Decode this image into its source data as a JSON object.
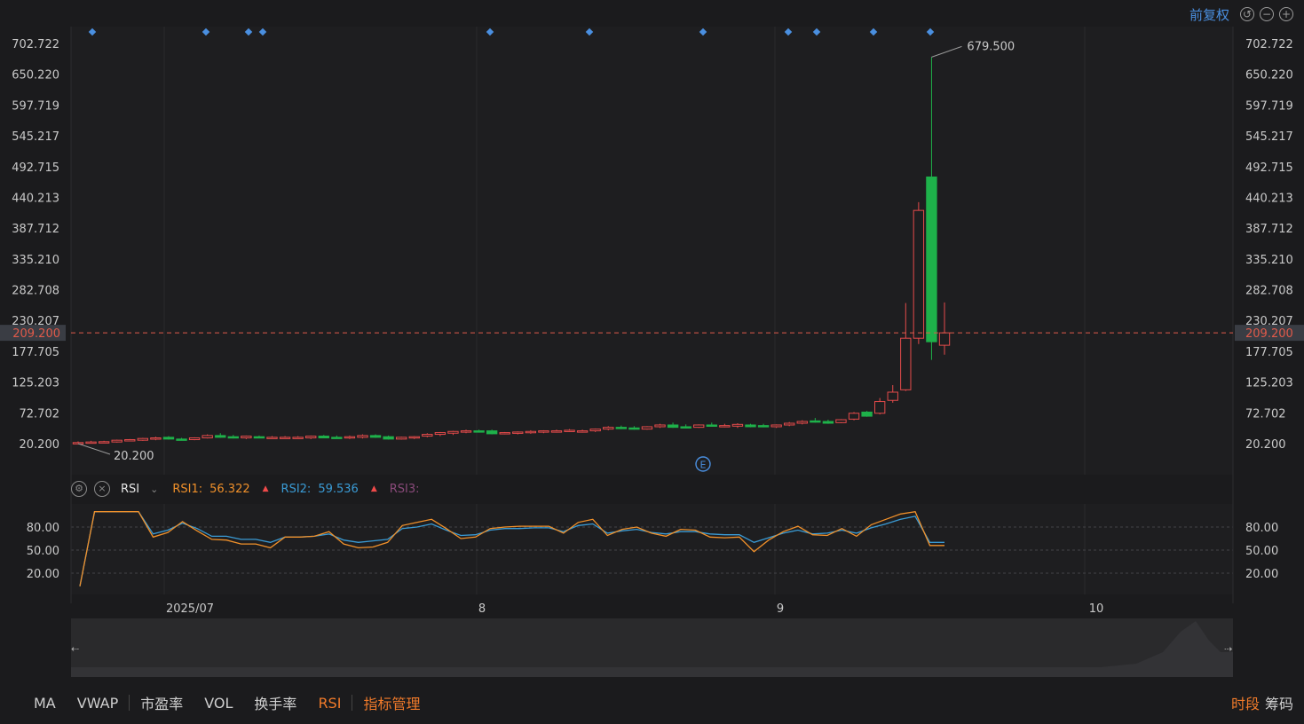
{
  "toolbar": {
    "adjust_label": "前复权"
  },
  "price_axis": {
    "ticks": [
      "702.722",
      "650.220",
      "597.719",
      "545.217",
      "492.715",
      "440.213",
      "387.712",
      "335.210",
      "282.708",
      "230.207",
      "177.705",
      "125.203",
      "72.702",
      "20.200"
    ],
    "current_price_label": "209.200"
  },
  "annotations": {
    "high_label": "679.500",
    "low_label": "20.200",
    "event_marker": "E"
  },
  "date_axis": {
    "labels": [
      "2025/07",
      "8",
      "9",
      "10"
    ]
  },
  "indicator": {
    "name": "RSI",
    "rsi1_label": "RSI1:",
    "rsi1_value": "56.322",
    "rsi2_label": "RSI2:",
    "rsi2_value": "59.536",
    "rsi3_label": "RSI3:",
    "axis_ticks": [
      "80.00",
      "50.00",
      "20.00"
    ]
  },
  "bottom_tabs": [
    "MA",
    "VWAP",
    "市盈率",
    "VOL",
    "换手率",
    "RSI",
    "指标管理"
  ],
  "bottom_right": [
    "时段",
    "筹码"
  ],
  "colors": {
    "up": "#e54b4b",
    "down": "#1eb14a",
    "accent_blue": "#4a8fe0",
    "rsi1": "#f0902a",
    "rsi2": "#3a9bd5",
    "rsi3": "#8a4a7a",
    "current_price": "#e05a4a"
  },
  "chart_data": [
    {
      "type": "candlestick",
      "ylim": [
        20.2,
        702.722
      ],
      "current_price": 209.2,
      "high": 679.5,
      "low": 20.2,
      "candles": [
        {
          "o": 20.2,
          "h": 24,
          "l": 20.2,
          "c": 22
        },
        {
          "o": 22,
          "h": 25,
          "l": 21,
          "c": 23
        },
        {
          "o": 22,
          "h": 25,
          "l": 21,
          "c": 23.5
        },
        {
          "o": 23,
          "h": 27,
          "l": 22,
          "c": 26
        },
        {
          "o": 25,
          "h": 28,
          "l": 24,
          "c": 27
        },
        {
          "o": 26,
          "h": 30,
          "l": 25,
          "c": 29
        },
        {
          "o": 28,
          "h": 32,
          "l": 26,
          "c": 30
        },
        {
          "o": 31,
          "h": 33,
          "l": 27,
          "c": 28
        },
        {
          "o": 28,
          "h": 30,
          "l": 26,
          "c": 27
        },
        {
          "o": 27,
          "h": 31,
          "l": 26,
          "c": 30
        },
        {
          "o": 30,
          "h": 36,
          "l": 29,
          "c": 34
        },
        {
          "o": 34,
          "h": 38,
          "l": 30,
          "c": 31
        },
        {
          "o": 32,
          "h": 35,
          "l": 29,
          "c": 30
        },
        {
          "o": 30,
          "h": 34,
          "l": 28,
          "c": 33
        },
        {
          "o": 32,
          "h": 34,
          "l": 30,
          "c": 31
        },
        {
          "o": 31,
          "h": 33,
          "l": 29,
          "c": 31
        },
        {
          "o": 31,
          "h": 33,
          "l": 29,
          "c": 31
        },
        {
          "o": 31,
          "h": 33,
          "l": 29,
          "c": 31
        },
        {
          "o": 30,
          "h": 34,
          "l": 28,
          "c": 33
        },
        {
          "o": 33,
          "h": 35,
          "l": 30,
          "c": 30
        },
        {
          "o": 31,
          "h": 34,
          "l": 29,
          "c": 30
        },
        {
          "o": 30,
          "h": 34,
          "l": 28,
          "c": 32
        },
        {
          "o": 31,
          "h": 36,
          "l": 29,
          "c": 34
        },
        {
          "o": 34,
          "h": 36,
          "l": 30,
          "c": 31
        },
        {
          "o": 32,
          "h": 34,
          "l": 27,
          "c": 28
        },
        {
          "o": 28,
          "h": 32,
          "l": 27,
          "c": 31
        },
        {
          "o": 30,
          "h": 33,
          "l": 28,
          "c": 32
        },
        {
          "o": 33,
          "h": 38,
          "l": 31,
          "c": 36
        },
        {
          "o": 36,
          "h": 40,
          "l": 33,
          "c": 39
        },
        {
          "o": 38,
          "h": 42,
          "l": 35,
          "c": 41
        },
        {
          "o": 41,
          "h": 44,
          "l": 38,
          "c": 42
        },
        {
          "o": 42,
          "h": 44,
          "l": 39,
          "c": 41
        },
        {
          "o": 42,
          "h": 44,
          "l": 36,
          "c": 37
        },
        {
          "o": 38,
          "h": 40,
          "l": 36,
          "c": 39
        },
        {
          "o": 38,
          "h": 41,
          "l": 36,
          "c": 40
        },
        {
          "o": 40,
          "h": 43,
          "l": 37,
          "c": 41
        },
        {
          "o": 40,
          "h": 43,
          "l": 38,
          "c": 42
        },
        {
          "o": 41,
          "h": 44,
          "l": 39,
          "c": 42
        },
        {
          "o": 42,
          "h": 45,
          "l": 40,
          "c": 43
        },
        {
          "o": 41,
          "h": 44,
          "l": 39,
          "c": 42
        },
        {
          "o": 42,
          "h": 46,
          "l": 40,
          "c": 45
        },
        {
          "o": 45,
          "h": 50,
          "l": 43,
          "c": 48
        },
        {
          "o": 48,
          "h": 51,
          "l": 45,
          "c": 46
        },
        {
          "o": 47,
          "h": 50,
          "l": 44,
          "c": 45
        },
        {
          "o": 45,
          "h": 50,
          "l": 44,
          "c": 49
        },
        {
          "o": 49,
          "h": 54,
          "l": 47,
          "c": 52
        },
        {
          "o": 52,
          "h": 56,
          "l": 47,
          "c": 48
        },
        {
          "o": 49,
          "h": 53,
          "l": 46,
          "c": 47
        },
        {
          "o": 48,
          "h": 53,
          "l": 47,
          "c": 52
        },
        {
          "o": 52,
          "h": 56,
          "l": 49,
          "c": 50
        },
        {
          "o": 50,
          "h": 54,
          "l": 48,
          "c": 51
        },
        {
          "o": 50,
          "h": 55,
          "l": 47,
          "c": 53
        },
        {
          "o": 52,
          "h": 54,
          "l": 48,
          "c": 49
        },
        {
          "o": 51,
          "h": 54,
          "l": 48,
          "c": 49
        },
        {
          "o": 49,
          "h": 53,
          "l": 47,
          "c": 52
        },
        {
          "o": 52,
          "h": 57,
          "l": 50,
          "c": 55
        },
        {
          "o": 55,
          "h": 60,
          "l": 53,
          "c": 58
        },
        {
          "o": 59,
          "h": 64,
          "l": 56,
          "c": 58
        },
        {
          "o": 58,
          "h": 61,
          "l": 54,
          "c": 55
        },
        {
          "o": 56,
          "h": 62,
          "l": 55,
          "c": 61
        },
        {
          "o": 62,
          "h": 74,
          "l": 60,
          "c": 72
        },
        {
          "o": 74,
          "h": 76,
          "l": 66,
          "c": 67
        },
        {
          "o": 72,
          "h": 98,
          "l": 70,
          "c": 92
        },
        {
          "o": 94,
          "h": 120,
          "l": 90,
          "c": 108
        },
        {
          "o": 112,
          "h": 260,
          "l": 110,
          "c": 200
        },
        {
          "o": 200,
          "h": 432,
          "l": 190,
          "c": 418
        },
        {
          "o": 475,
          "h": 679.5,
          "l": 163,
          "c": 194
        },
        {
          "o": 188,
          "h": 261,
          "l": 172,
          "c": 209.2
        }
      ]
    },
    {
      "type": "line",
      "title": "RSI",
      "ylim": [
        0,
        100
      ],
      "series": [
        {
          "name": "RSI1",
          "values": [
            3,
            100,
            100,
            100,
            100,
            67,
            73,
            87,
            75,
            64,
            63,
            58,
            58,
            53,
            67,
            67,
            68,
            74,
            58,
            53,
            54,
            60,
            82,
            86,
            90,
            78,
            65,
            67,
            78,
            80,
            81,
            81,
            81,
            72,
            86,
            90,
            69,
            77,
            80,
            72,
            68,
            77,
            76,
            67,
            66,
            67,
            48,
            63,
            74,
            81,
            70,
            69,
            78,
            68,
            83,
            90,
            97,
            100,
            56,
            56
          ]
        },
        {
          "name": "RSI2",
          "values": [
            3,
            100,
            100,
            100,
            100,
            71,
            76,
            85,
            78,
            68,
            68,
            64,
            64,
            60,
            67,
            67,
            68,
            71,
            63,
            60,
            62,
            64,
            78,
            80,
            84,
            76,
            69,
            70,
            76,
            78,
            78,
            79,
            79,
            74,
            82,
            84,
            72,
            75,
            77,
            73,
            71,
            74,
            74,
            71,
            70,
            70,
            60,
            66,
            72,
            76,
            71,
            72,
            76,
            72,
            79,
            84,
            90,
            94,
            60,
            60
          ]
        }
      ]
    }
  ]
}
